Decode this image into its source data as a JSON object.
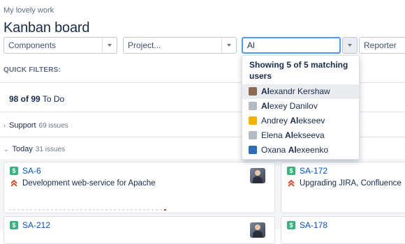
{
  "breadcrumb": "My lovely work",
  "page_title": "Kanban board",
  "filters": {
    "components": "Components",
    "project": "Project...",
    "user_search_value": "Al",
    "reporter": "Reporter"
  },
  "quick_filters_label": "QUICK FILTERS:",
  "column": {
    "count": "98 of 99",
    "name": "To Do"
  },
  "swimlanes": [
    {
      "name": "Support",
      "count": "69 issues"
    },
    {
      "name": "Today",
      "count": "31 issues"
    }
  ],
  "cards": [
    {
      "type_icon": "$",
      "key": "SA-6",
      "summary": "Development web-service for Apache"
    },
    {
      "type_icon": "$",
      "key": "SA-172",
      "summary": "Upgrading JIRA, Confluence"
    },
    {
      "type_icon": "$",
      "key": "SA-212",
      "summary": ""
    },
    {
      "type_icon": "$",
      "key": "SA-178",
      "summary": ""
    }
  ],
  "dropdown": {
    "header": "Showing 5 of 5 matching users",
    "users": [
      {
        "pre": "",
        "match": "Al",
        "post": "exandr Kershaw",
        "avatar_color": "#8a6a52",
        "active": true
      },
      {
        "pre": "",
        "match": "Al",
        "post": "exey Danilov",
        "avatar_color": "#b3bac5",
        "active": false
      },
      {
        "pre": "Andrey ",
        "match": "Al",
        "post": "ekseev",
        "avatar_color": "#f4b400",
        "active": false
      },
      {
        "pre": "Elena ",
        "match": "Al",
        "post": "ekseeva",
        "avatar_color": "#b3bac5",
        "active": false
      },
      {
        "pre": "Oxana ",
        "match": "Al",
        "post": "exeenko",
        "avatar_color": "#2f6eb5",
        "active": false
      }
    ]
  },
  "colors": {
    "accent": "#0052cc",
    "story_green": "#36b37e",
    "priority_red": "#de350b",
    "focus_border": "#4c9aff"
  }
}
